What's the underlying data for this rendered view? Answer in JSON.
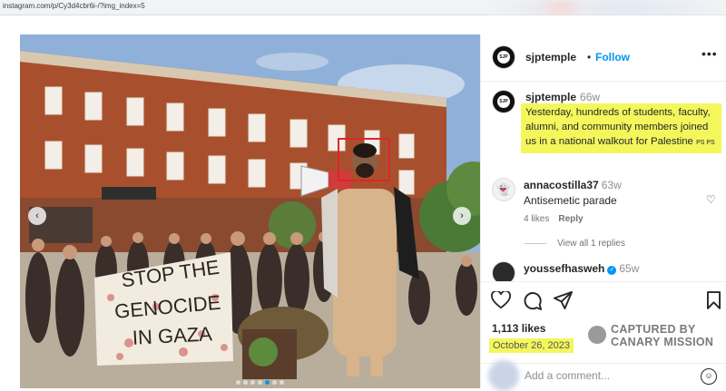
{
  "browser": {
    "url": "instagram.com/p/Cy3d4cbr6i-/?img_index=5"
  },
  "post": {
    "account": "sjptemple",
    "avatar_text": "SJP",
    "follow_label": "Follow",
    "separator": "•",
    "more_label": "•••",
    "caption": {
      "username": "sjptemple",
      "time": "66w",
      "text": "Yesterday, hundreds of students, faculty, alumni, and community members joined us in a national walkout for Palestine",
      "flags": "PS PS"
    },
    "photo": {
      "banner_text": [
        "STOP THE",
        "GENOCIDE",
        "IN GAZA"
      ],
      "prev_label": "‹",
      "next_label": "›",
      "slide_count": 7,
      "active_slide": 4
    },
    "comments": [
      {
        "username": "annacostilla37",
        "time": "63w",
        "text": "Antisemetic parade",
        "likes": "4 likes",
        "reply_label": "Reply"
      },
      {
        "username": "youssefhasweh",
        "time": "65w"
      }
    ],
    "view_replies": "View all 1 replies",
    "likes": "1,113 likes",
    "date": "October 26, 2023",
    "add_comment_placeholder": "Add a comment..."
  },
  "watermark": {
    "line1": "CAPTURED BY",
    "line2": "CANARY MISSION"
  },
  "colors": {
    "highlight": "#f3f75c",
    "link_blue": "#0095f6",
    "red_box": "#e0252b"
  }
}
